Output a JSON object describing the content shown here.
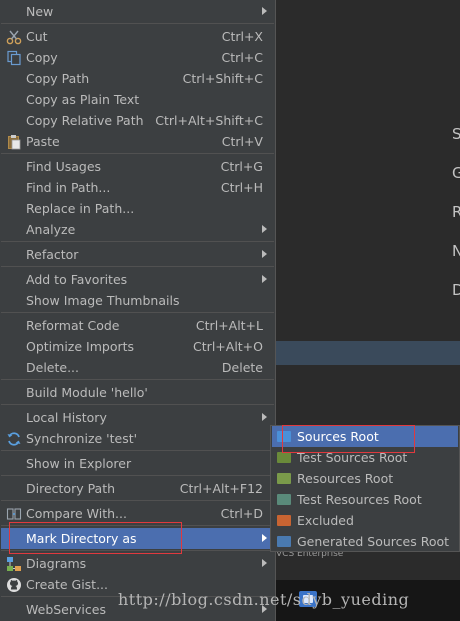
{
  "menu": {
    "items": [
      {
        "label": "New",
        "shortcut": "",
        "submenu": true
      },
      {
        "label": "Cut",
        "shortcut": "Ctrl+X",
        "icon": "scissors-icon"
      },
      {
        "label": "Copy",
        "shortcut": "Ctrl+C",
        "icon": "copy-icon"
      },
      {
        "label": "Copy Path",
        "shortcut": "Ctrl+Shift+C"
      },
      {
        "label": "Copy as Plain Text",
        "shortcut": ""
      },
      {
        "label": "Copy Relative Path",
        "shortcut": "Ctrl+Alt+Shift+C"
      },
      {
        "label": "Paste",
        "shortcut": "Ctrl+V",
        "icon": "paste-icon"
      },
      {
        "label": "Find Usages",
        "shortcut": "Ctrl+G"
      },
      {
        "label": "Find in Path...",
        "shortcut": "Ctrl+H"
      },
      {
        "label": "Replace in Path...",
        "shortcut": ""
      },
      {
        "label": "Analyze",
        "shortcut": "",
        "submenu": true
      },
      {
        "label": "Refactor",
        "shortcut": "",
        "submenu": true
      },
      {
        "label": "Add to Favorites",
        "shortcut": "",
        "submenu": true
      },
      {
        "label": "Show Image Thumbnails",
        "shortcut": ""
      },
      {
        "label": "Reformat Code",
        "shortcut": "Ctrl+Alt+L"
      },
      {
        "label": "Optimize Imports",
        "shortcut": "Ctrl+Alt+O"
      },
      {
        "label": "Delete...",
        "shortcut": "Delete"
      },
      {
        "label": "Build Module 'hello'",
        "shortcut": ""
      },
      {
        "label": "Local History",
        "shortcut": "",
        "submenu": true
      },
      {
        "label": "Synchronize 'test'",
        "shortcut": "",
        "icon": "sync-icon"
      },
      {
        "label": "Show in Explorer",
        "shortcut": ""
      },
      {
        "label": "Directory Path",
        "shortcut": "Ctrl+Alt+F12"
      },
      {
        "label": "Compare With...",
        "shortcut": "Ctrl+D",
        "icon": "compare-icon"
      },
      {
        "label": "Mark Directory as",
        "shortcut": "",
        "submenu": true,
        "selected": true
      },
      {
        "label": "Diagrams",
        "shortcut": "",
        "submenu": true,
        "icon": "diagram-icon"
      },
      {
        "label": "Create Gist...",
        "shortcut": "",
        "icon": "github-icon"
      },
      {
        "label": "WebServices",
        "shortcut": "",
        "submenu": true
      }
    ]
  },
  "submenu": {
    "items": [
      {
        "label": "Sources Root",
        "color": "#4a90d9",
        "selected": true
      },
      {
        "label": "Test Sources Root",
        "color": "#6a8a3a"
      },
      {
        "label": "Resources Root",
        "color": "#7a9a4a"
      },
      {
        "label": "Test Resources Root",
        "color": "#5a8a7a"
      },
      {
        "label": "Excluded",
        "color": "#c86432"
      },
      {
        "label": "Generated Sources Root",
        "color": "#4a7ab0"
      }
    ]
  },
  "background": {
    "letters": [
      "S",
      "G",
      "R",
      "N",
      "D"
    ],
    "sliver_text": "VCS Enterprise"
  },
  "watermark": {
    "text": "http://blog.csdn.net/sdyb_yueding"
  },
  "colors": {
    "menu_bg": "#3c3f41",
    "selection": "#4b6eaf",
    "highlight_border": "#e0393e",
    "editor_bg": "#2b2b2b"
  }
}
